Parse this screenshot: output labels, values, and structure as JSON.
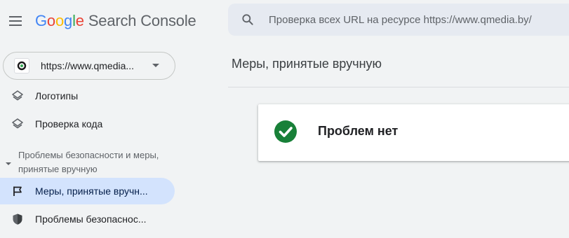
{
  "header": {
    "logo": {
      "G": "G",
      "o1": "o",
      "o2": "o",
      "g": "g",
      "l": "l",
      "e": "e",
      "product": "Search Console"
    },
    "search": {
      "placeholder": "Проверка всех URL на ресурсе https://www.qmedia.by/"
    }
  },
  "sidebar": {
    "property": {
      "label": "https://www.qmedia..."
    },
    "items": [
      {
        "label": "Логотипы",
        "icon": "layers-icon"
      },
      {
        "label": "Проверка кода",
        "icon": "layers-icon"
      }
    ],
    "section": {
      "title": "Проблемы безопасности и меры, принятые вручную",
      "expanded": true
    },
    "section_items": [
      {
        "label": "Меры, принятые вручн...",
        "icon": "flag-icon",
        "active": true
      },
      {
        "label": "Проблемы безопаснос...",
        "icon": "shield-icon",
        "active": false
      }
    ]
  },
  "main": {
    "title": "Меры, принятые вручную",
    "status": {
      "message": "Проблем нет",
      "icon": "check-circle-icon",
      "color": "#188038"
    }
  },
  "colors": {
    "active_bg": "#d3e3fd",
    "background": "#f1f3f4",
    "success": "#188038"
  }
}
